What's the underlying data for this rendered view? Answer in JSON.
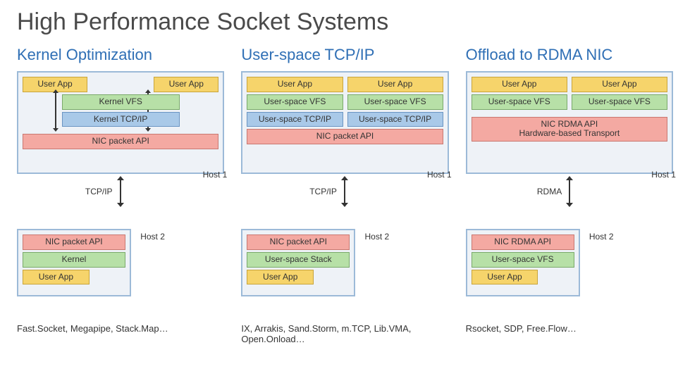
{
  "title": "High Performance Socket Systems",
  "columns": [
    {
      "heading": "Kernel Optimization",
      "host1": {
        "label": "Host 1",
        "apps": [
          "User App",
          "User App"
        ],
        "layers": [
          "Kernel VFS",
          "Kernel TCP/IP",
          "NIC packet API"
        ]
      },
      "link": "TCP/IP",
      "host2": {
        "label": "Host 2",
        "stack": [
          "NIC packet API",
          "Kernel",
          "User App"
        ]
      },
      "examples": "Fast.Socket, Megapipe, Stack.Map…"
    },
    {
      "heading": "User-space TCP/IP",
      "host1": {
        "label": "Host 1",
        "apps": [
          "User App",
          "User App"
        ],
        "vfs": [
          "User-space VFS",
          "User-space VFS"
        ],
        "tcp": [
          "User-space TCP/IP",
          "User-space TCP/IP"
        ],
        "nic": "NIC packet API"
      },
      "link": "TCP/IP",
      "host2": {
        "label": "Host 2",
        "stack": [
          "NIC packet API",
          "User-space Stack",
          "User App"
        ]
      },
      "examples": "IX, Arrakis, Sand.Storm, m.TCP, Lib.VMA, Open.Onload…"
    },
    {
      "heading": "Offload to RDMA NIC",
      "host1": {
        "label": "Host 1",
        "apps": [
          "User App",
          "User App"
        ],
        "vfs": [
          "User-space VFS",
          "User-space VFS"
        ],
        "nic_lines": [
          "NIC RDMA API",
          "Hardware-based Transport"
        ]
      },
      "link": "RDMA",
      "host2": {
        "label": "Host 2",
        "stack": [
          "NIC RDMA API",
          "User-space VFS",
          "User App"
        ]
      },
      "examples": "Rsocket, SDP, Free.Flow…"
    }
  ]
}
